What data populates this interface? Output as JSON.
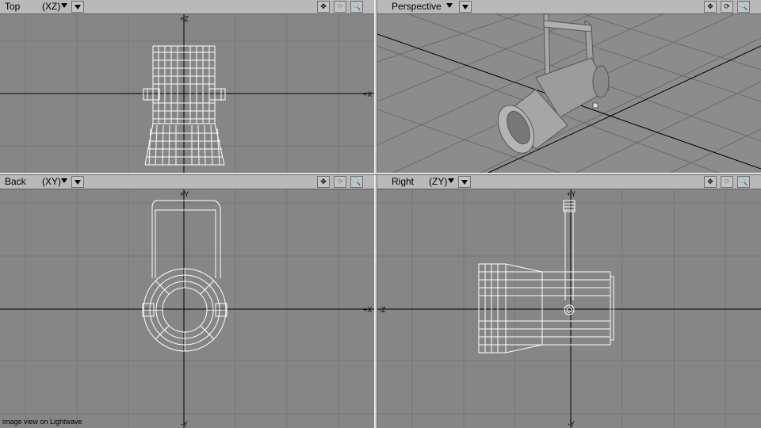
{
  "viewports": {
    "top": {
      "name": "Top",
      "axes": "(XZ)",
      "axis_h_label": "+X",
      "axis_v_label": "+Z",
      "axis_v_bottom": "-Z"
    },
    "perspective": {
      "name": "Perspective"
    },
    "back": {
      "name": "Back",
      "axes": "(XY)",
      "axis_h_label": "+X",
      "axis_v_label": "+Y",
      "axis_v_bottom": "-Y"
    },
    "right": {
      "name": "Right",
      "axes": "(ZY)",
      "axis_h_label": "-Z",
      "axis_v_label": "+Y",
      "axis_v_bottom": "-Y"
    }
  },
  "toolbar_icons": [
    "move-icon",
    "rotate-icon",
    "zoom-icon"
  ],
  "caption": "image view on Lightwave",
  "colors": {
    "viewport_bg": "#868686",
    "grid": "#777777",
    "wire": "#ffffff",
    "axis": "#000000",
    "header": "#b9b9b9"
  }
}
